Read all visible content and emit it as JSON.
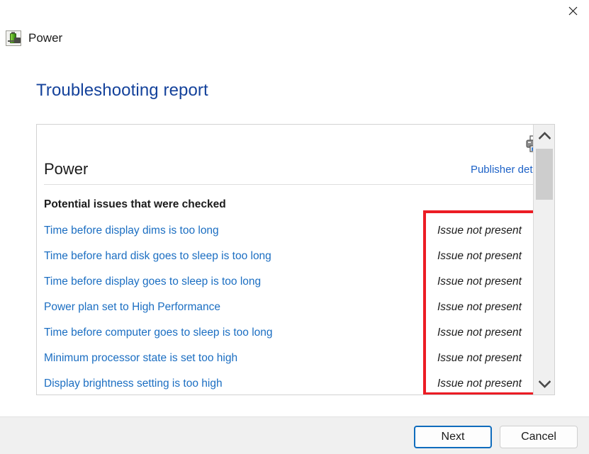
{
  "window": {
    "close_label": "Close",
    "app_name": "Power",
    "app_icon": "power-battery-icon"
  },
  "page": {
    "title": "Troubleshooting report"
  },
  "report": {
    "print_icon": "printer-icon",
    "title": "Power",
    "publisher_details_label": "Publisher details",
    "section_heading": "Potential issues that were checked",
    "issues": [
      {
        "name": "Time before display dims is too long",
        "status": "Issue not present"
      },
      {
        "name": "Time before hard disk goes to sleep is too long",
        "status": "Issue not present"
      },
      {
        "name": "Time before display goes to sleep is too long",
        "status": "Issue not present"
      },
      {
        "name": "Power plan set to High Performance",
        "status": "Issue not present"
      },
      {
        "name": "Time before computer goes to sleep is too long",
        "status": "Issue not present"
      },
      {
        "name": "Minimum processor state is set too high",
        "status": "Issue not present"
      },
      {
        "name": "Display brightness setting is too high",
        "status": "Issue not present"
      }
    ]
  },
  "annotation": {
    "highlight_color": "#ec1c24"
  },
  "scrollbar": {
    "up_label": "Scroll up",
    "down_label": "Scroll down"
  },
  "footer": {
    "next_label": "Next",
    "cancel_label": "Cancel"
  },
  "colors": {
    "link": "#1b6ec2",
    "title": "#14429b",
    "accent": "#0f6cbd"
  }
}
